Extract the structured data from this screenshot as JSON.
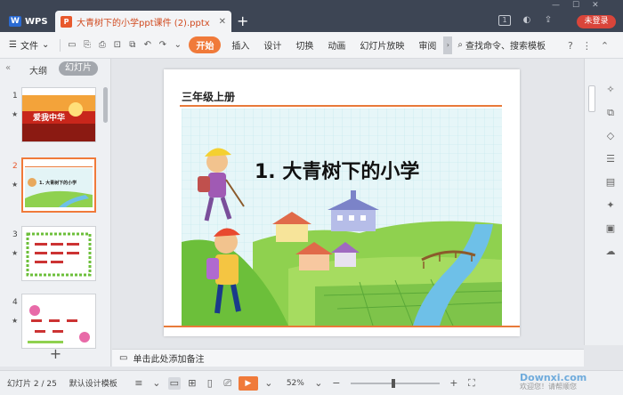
{
  "titlebar": {
    "app_tab": "WPS",
    "doc_tab": "大青树下的小学ppt课件 (2).pptx",
    "new_tab_glyph": "+",
    "login_label": "未登录",
    "page_badge": "1"
  },
  "ribbon": {
    "file_label": "文件",
    "tabs": [
      "开始",
      "插入",
      "设计",
      "切换",
      "动画",
      "幻灯片放映",
      "审阅"
    ],
    "active_tab": "开始",
    "search_label": "查找命令、搜索模板"
  },
  "left_panel": {
    "tab_outline": "大纲",
    "tab_slides": "幻灯片",
    "slides": [
      {
        "num": "1",
        "title": "爱我中华"
      },
      {
        "num": "2",
        "title": "1. 大青树下的小学"
      },
      {
        "num": "3",
        "title": ""
      },
      {
        "num": "4",
        "title": ""
      }
    ],
    "selected": "2",
    "add_glyph": "+"
  },
  "slide": {
    "header": "三年级上册",
    "title": "1. 大青树下的小学"
  },
  "notes": {
    "placeholder": "单击此处添加备注"
  },
  "status": {
    "slide_counter": "幻灯片 2 / 25",
    "template": "默认设计模板",
    "zoom": "52%"
  },
  "watermark": {
    "brand": "Downxi.com",
    "sub": "欢迎您！请帮顺您"
  },
  "colors": {
    "titlebar": "#3d4554",
    "accent": "#f07a3a",
    "login": "#d9453a"
  }
}
